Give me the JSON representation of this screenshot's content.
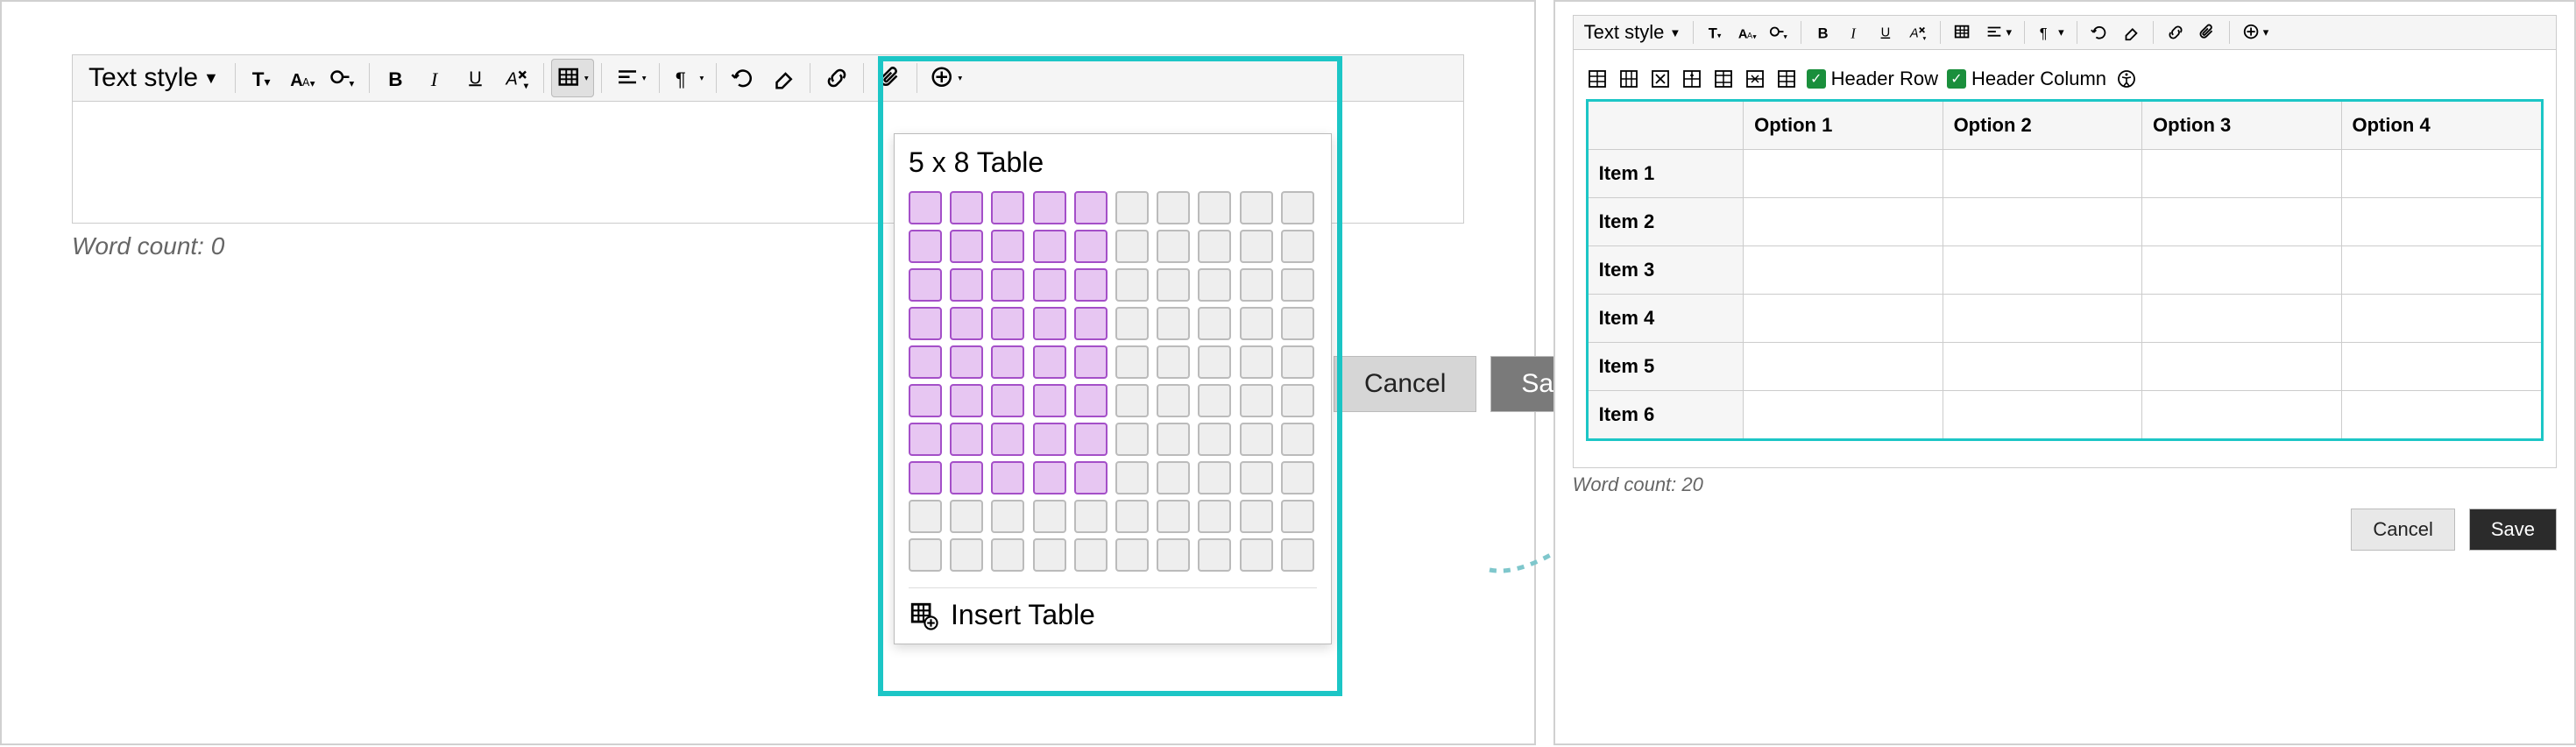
{
  "left": {
    "text_style_label": "Text style",
    "word_count_label": "Word count: 0",
    "cancel_label": "Cancel",
    "save_label": "Save",
    "dropdown": {
      "title": "5 x 8 Table",
      "selected_cols": 5,
      "selected_rows": 8,
      "total_cols": 10,
      "total_rows": 10,
      "insert_label": "Insert Table"
    }
  },
  "right": {
    "text_style_label": "Text style",
    "word_count_label": "Word count: 20",
    "cancel_label": "Cancel",
    "save_label": "Save",
    "header_row_label": "Header Row",
    "header_col_label": "Header Column",
    "table": {
      "cols": [
        "",
        "Option 1",
        "Option 2",
        "Option 3",
        "Option 4"
      ],
      "rows": [
        "Item 1",
        "Item 2",
        "Item 3",
        "Item 4",
        "Item 5",
        "Item 6"
      ]
    }
  },
  "icons": {
    "text_style": "Text style",
    "heading": "T",
    "font_size": "Aᴀ",
    "inline": "inline",
    "bold": "B",
    "italic": "I",
    "underline": "U",
    "clear_fmt": "A×",
    "table": "table",
    "align": "align",
    "paragraph": "¶",
    "undo": "undo",
    "erase": "erase",
    "link": "link",
    "attach": "attach",
    "more": "more"
  }
}
